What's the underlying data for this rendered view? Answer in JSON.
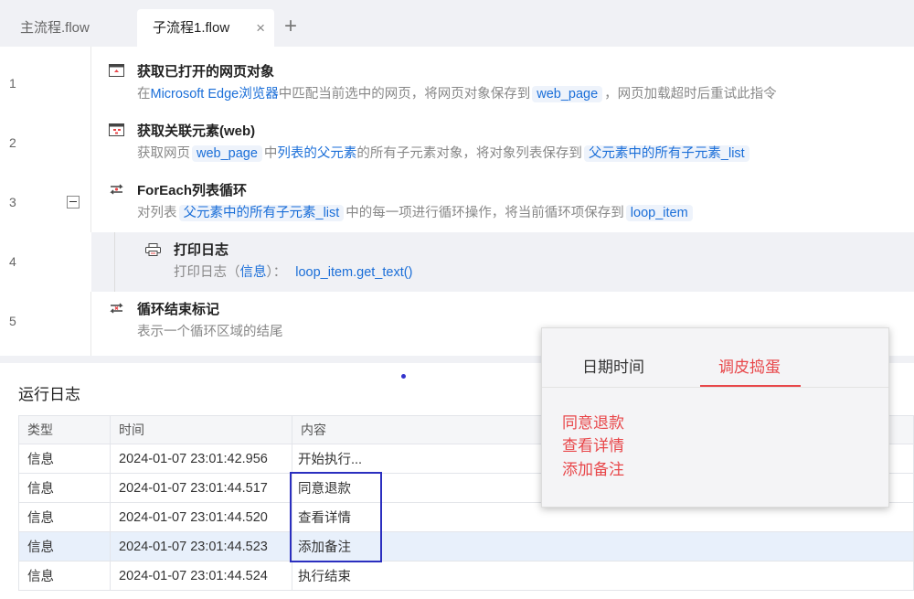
{
  "tabs": [
    {
      "label": "主流程.flow"
    },
    {
      "label": "子流程1.flow"
    }
  ],
  "tab_close": "×",
  "tab_add": "+",
  "lines": [
    {
      "num": "1",
      "title": "获取已打开的网页对象",
      "d1": "在",
      "d2": "Microsoft Edge浏览器",
      "d3": "中匹配当前选中的网页，将网页对象保存到",
      "v1": "web_page",
      "d4": "，网页加载超时后重试此指令"
    },
    {
      "num": "2",
      "title": "获取关联元素(web)",
      "d1": "获取网页",
      "v1": "web_page",
      "d2": "中",
      "d3": "列表的父元素",
      "d4": "的所有子元素对象，将对象列表保存到",
      "v2": "父元素中的所有子元素_list"
    },
    {
      "num": "3",
      "title": "ForEach列表循环",
      "d1": "对列表",
      "v1": "父元素中的所有子元素_list",
      "d2": "中的每一项进行循环操作，将当前循环项保存到",
      "v2": "loop_item"
    },
    {
      "num": "4",
      "title": "打印日志",
      "d1": "打印日志（",
      "d2": "信息",
      "d3": "）：",
      "expr": "loop_item.get_text()"
    },
    {
      "num": "5",
      "title": "循环结束标记",
      "d1": "表示一个循环区域的结尾"
    }
  ],
  "log": {
    "title": "运行日志",
    "headers": [
      "类型",
      "时间",
      "内容"
    ],
    "rows": [
      [
        "信息",
        "2024-01-07 23:01:42.956",
        "开始执行..."
      ],
      [
        "信息",
        "2024-01-07 23:01:44.517",
        "同意退款"
      ],
      [
        "信息",
        "2024-01-07 23:01:44.520",
        "查看详情"
      ],
      [
        "信息",
        "2024-01-07 23:01:44.523",
        "添加备注"
      ],
      [
        "信息",
        "2024-01-07 23:01:44.524",
        "执行结束"
      ]
    ]
  },
  "popup": {
    "tabs": [
      "日期时间",
      "调皮捣蛋"
    ],
    "items": [
      "同意退款",
      "查看详情",
      "添加备注"
    ]
  },
  "colors": {
    "accent_red": "#e8474a",
    "link_blue": "#1a6ed8",
    "highlight_box": "#2b2fbf"
  }
}
